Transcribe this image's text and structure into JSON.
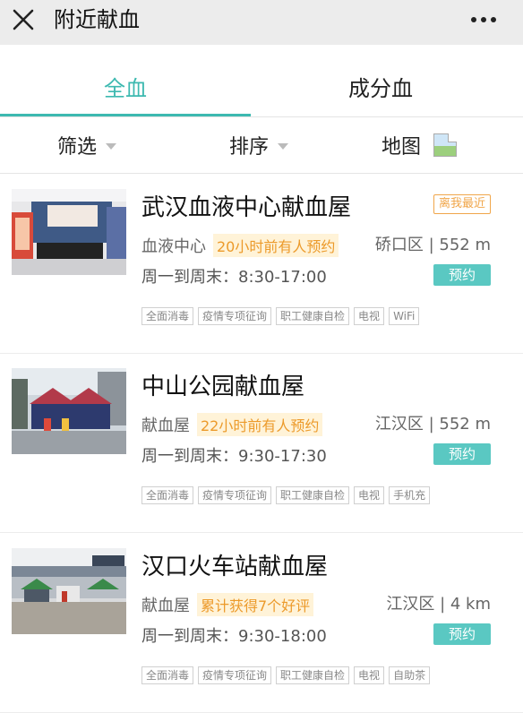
{
  "header": {
    "title": "附近献血",
    "close_icon": "close-icon",
    "more_icon": "more-icon"
  },
  "tabs": [
    {
      "label": "全血",
      "active": true
    },
    {
      "label": "成分血",
      "active": false
    }
  ],
  "filters": {
    "filter_label": "筛选",
    "sort_label": "排序",
    "map_label": "地图"
  },
  "colors": {
    "accent": "#3db9b0",
    "reserve_bg": "#5ac8c2",
    "highlight_text": "#ec9a2a",
    "nearest_border": "#f0a64a"
  },
  "sites": [
    {
      "name": "武汉血液中心献血屋",
      "badge": "离我最近",
      "type": "血液中心",
      "highlight": "20小时前有人预约",
      "distance": "硚口区 | 552 m",
      "hours": "周一到周末：8:30-17:00",
      "button": "预约",
      "tags": [
        "全面消毒",
        "疫情专项征询",
        "职工健康自检",
        "电视",
        "WiFi"
      ]
    },
    {
      "name": "中山公园献血屋",
      "type": "献血屋",
      "highlight": "22小时前有人预约",
      "distance": "江汉区 | 552 m",
      "hours": "周一到周末：9:30-17:30",
      "button": "预约",
      "tags": [
        "全面消毒",
        "疫情专项征询",
        "职工健康自检",
        "电视",
        "手机充"
      ]
    },
    {
      "name": "汉口火车站献血屋",
      "type": "献血屋",
      "highlight": "累计获得7个好评",
      "distance": "江汉区 | 4 km",
      "hours": "周一到周末：9:30-18:00",
      "button": "预约",
      "tags": [
        "全面消毒",
        "疫情专项征询",
        "职工健康自检",
        "电视",
        "自助茶"
      ]
    }
  ]
}
